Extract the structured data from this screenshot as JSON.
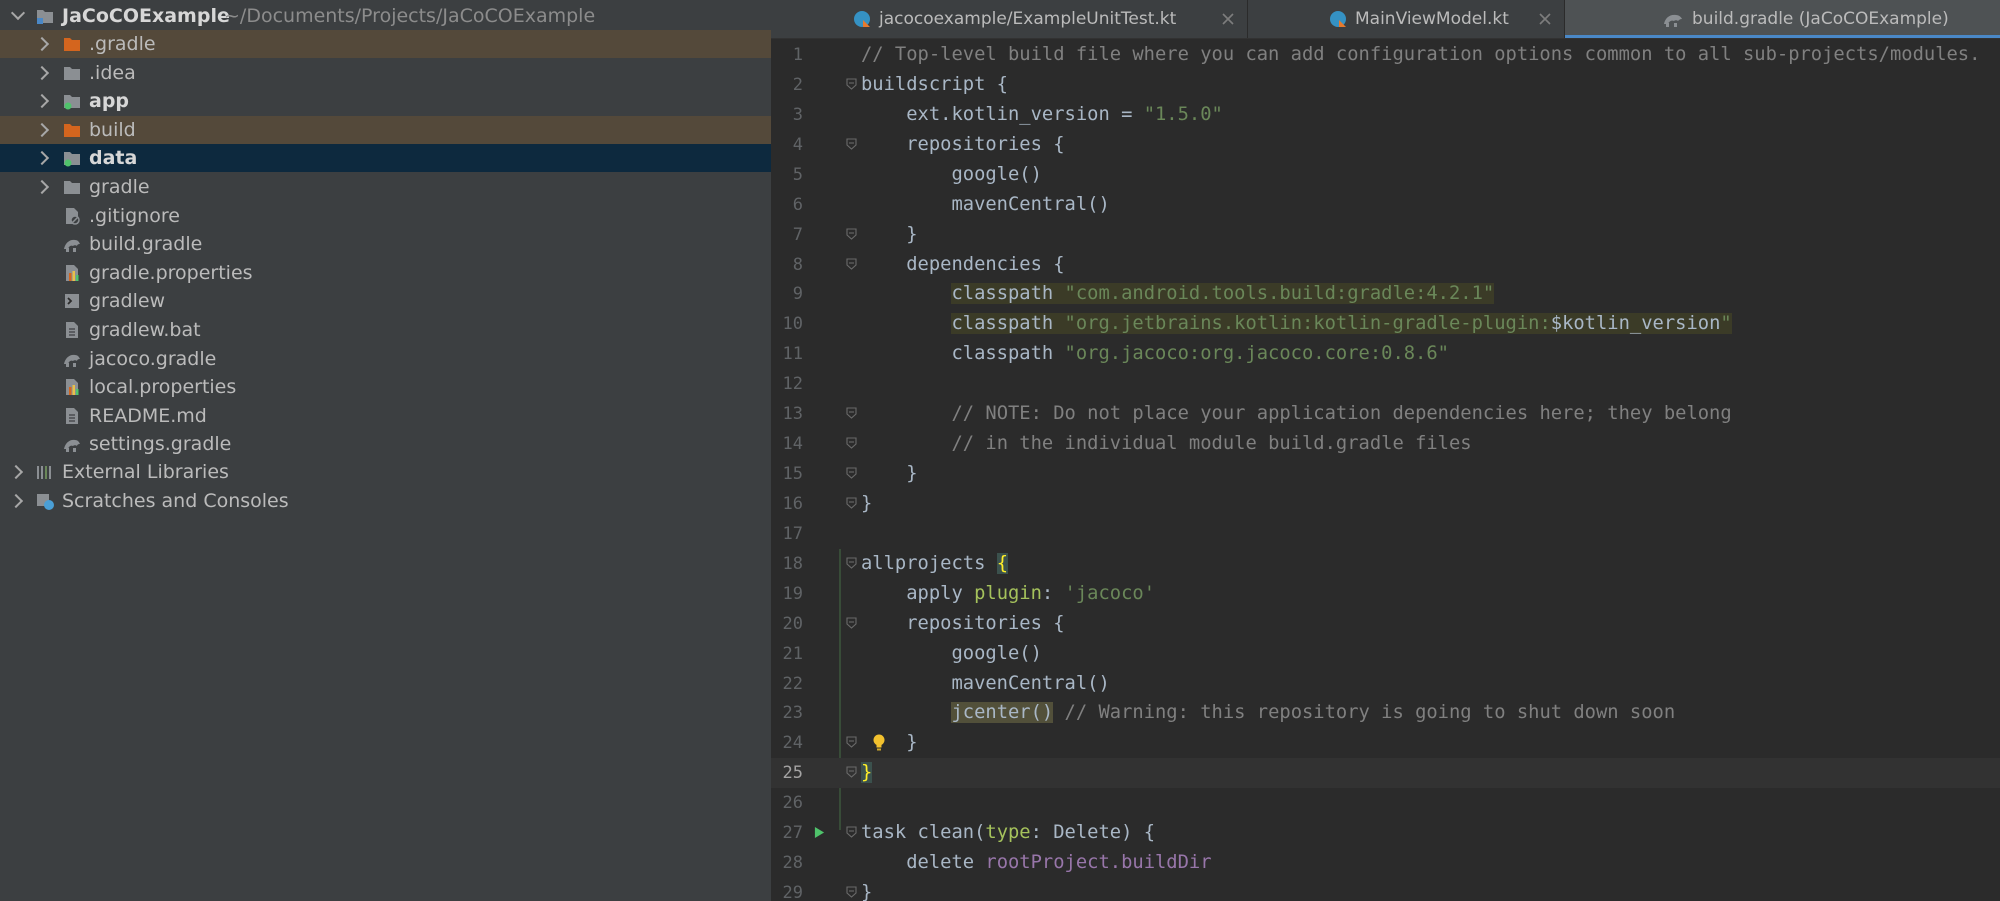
{
  "project": {
    "root_name": "JaCoCOExample",
    "root_path": "~/Documents/Projects/JaCoCOExample",
    "items": [
      {
        "label": ".gradle",
        "kind": "folder-orange",
        "expandable": true,
        "bold": false
      },
      {
        "label": ".idea",
        "kind": "folder",
        "expandable": true,
        "bold": false
      },
      {
        "label": "app",
        "kind": "module",
        "expandable": true,
        "bold": true
      },
      {
        "label": "build",
        "kind": "folder-orange",
        "expandable": true,
        "bold": false
      },
      {
        "label": "data",
        "kind": "module",
        "expandable": true,
        "bold": true
      },
      {
        "label": "gradle",
        "kind": "folder",
        "expandable": true,
        "bold": false
      },
      {
        "label": ".gitignore",
        "kind": "ignore-file",
        "expandable": false,
        "bold": false
      },
      {
        "label": "build.gradle",
        "kind": "gradle-file",
        "expandable": false,
        "bold": false
      },
      {
        "label": "gradle.properties",
        "kind": "properties-file",
        "expandable": false,
        "bold": false
      },
      {
        "label": "gradlew",
        "kind": "shell-file",
        "expandable": false,
        "bold": false
      },
      {
        "label": "gradlew.bat",
        "kind": "text-file",
        "expandable": false,
        "bold": false
      },
      {
        "label": "jacoco.gradle",
        "kind": "gradle-file",
        "expandable": false,
        "bold": false
      },
      {
        "label": "local.properties",
        "kind": "properties-file",
        "expandable": false,
        "bold": false
      },
      {
        "label": "README.md",
        "kind": "text-file",
        "expandable": false,
        "bold": false
      },
      {
        "label": "settings.gradle",
        "kind": "gradle-file",
        "expandable": false,
        "bold": false
      }
    ],
    "external_libraries": "External Libraries",
    "scratches": "Scratches and Consoles"
  },
  "tabs": [
    {
      "label": "jacocoexample/ExampleUnitTest.kt",
      "icon": "kotlin-class-icon",
      "active": false
    },
    {
      "label": "MainViewModel.kt",
      "icon": "kotlin-class-icon",
      "active": false
    },
    {
      "label": "build.gradle (JaCoCOExample)",
      "icon": "gradle-icon",
      "active": true
    }
  ],
  "editor": {
    "current_line": 25,
    "lines": [
      {
        "n": 1,
        "parts": [
          [
            "c-com",
            "// Top-level build file where you can add configuration options common to all sub-projects/modules."
          ]
        ]
      },
      {
        "n": 2,
        "parts": [
          [
            "",
            "buildscript {"
          ]
        ]
      },
      {
        "n": 3,
        "parts": [
          [
            "",
            "    ext.kotlin_version = "
          ],
          [
            "c-str",
            "\"1.5.0\""
          ]
        ]
      },
      {
        "n": 4,
        "parts": [
          [
            "",
            "    repositories {"
          ]
        ]
      },
      {
        "n": 5,
        "parts": [
          [
            "",
            "        google()"
          ]
        ]
      },
      {
        "n": 6,
        "parts": [
          [
            "",
            "        mavenCentral()"
          ]
        ]
      },
      {
        "n": 7,
        "parts": [
          [
            "",
            "    }"
          ]
        ]
      },
      {
        "n": 8,
        "parts": [
          [
            "",
            "    dependencies {"
          ]
        ]
      },
      {
        "n": 9,
        "parts": [
          [
            "",
            "        "
          ],
          [
            "c-hl",
            "classpath "
          ],
          [
            "c-str c-hl",
            "\"com.android.tools.build:gradle:4.2.1\""
          ]
        ]
      },
      {
        "n": 10,
        "parts": [
          [
            "",
            "        "
          ],
          [
            "c-hl",
            "classpath "
          ],
          [
            "c-str c-hl",
            "\"org.jetbrains.kotlin:kotlin-gradle-plugin:"
          ],
          [
            "c-hl",
            "$kotlin_version"
          ],
          [
            "c-str c-hl",
            "\""
          ]
        ]
      },
      {
        "n": 11,
        "parts": [
          [
            "",
            "        classpath "
          ],
          [
            "c-str",
            "\"org.jacoco:org.jacoco.core:0.8.6\""
          ]
        ]
      },
      {
        "n": 12,
        "parts": [
          [
            "",
            ""
          ]
        ]
      },
      {
        "n": 13,
        "parts": [
          [
            "",
            "        "
          ],
          [
            "c-com",
            "// NOTE: Do not place your application dependencies here; they belong"
          ]
        ]
      },
      {
        "n": 14,
        "parts": [
          [
            "",
            "        "
          ],
          [
            "c-com",
            "// in the individual module build.gradle files"
          ]
        ]
      },
      {
        "n": 15,
        "parts": [
          [
            "",
            "    }"
          ]
        ]
      },
      {
        "n": 16,
        "parts": [
          [
            "",
            "}"
          ]
        ]
      },
      {
        "n": 17,
        "parts": [
          [
            "",
            ""
          ]
        ]
      },
      {
        "n": 18,
        "parts": [
          [
            "",
            "allprojects "
          ],
          [
            "c-braceHl",
            "{"
          ]
        ]
      },
      {
        "n": 19,
        "parts": [
          [
            "",
            "    apply "
          ],
          [
            "c-param",
            "plugin"
          ],
          [
            "",
            ": "
          ],
          [
            "c-str",
            "'jacoco'"
          ]
        ]
      },
      {
        "n": 20,
        "parts": [
          [
            "",
            "    repositories {"
          ]
        ]
      },
      {
        "n": 21,
        "parts": [
          [
            "",
            "        google()"
          ]
        ]
      },
      {
        "n": 22,
        "parts": [
          [
            "",
            "        mavenCentral()"
          ]
        ]
      },
      {
        "n": 23,
        "parts": [
          [
            "",
            "        "
          ],
          [
            "c-warn",
            "jcenter()"
          ],
          [
            "",
            " "
          ],
          [
            "c-com",
            "// Warning: this repository is going to shut down soon"
          ]
        ]
      },
      {
        "n": 24,
        "parts": [
          [
            "",
            "    }"
          ]
        ]
      },
      {
        "n": 25,
        "parts": [
          [
            "c-braceHl",
            "}"
          ]
        ]
      },
      {
        "n": 26,
        "parts": [
          [
            "",
            ""
          ]
        ]
      },
      {
        "n": 27,
        "parts": [
          [
            "",
            "task clean("
          ],
          [
            "c-param",
            "type"
          ],
          [
            "",
            ": Delete) {"
          ]
        ]
      },
      {
        "n": 28,
        "parts": [
          [
            "",
            "    delete "
          ],
          [
            "c-named",
            "rootProject.buildDir"
          ]
        ]
      },
      {
        "n": 29,
        "parts": [
          [
            "",
            "}"
          ]
        ]
      }
    ],
    "fold_lines": [
      2,
      4,
      7,
      8,
      13,
      14,
      15,
      16,
      18,
      20,
      24,
      25,
      27,
      29
    ],
    "run_line": 27,
    "bulb_line": 24
  }
}
